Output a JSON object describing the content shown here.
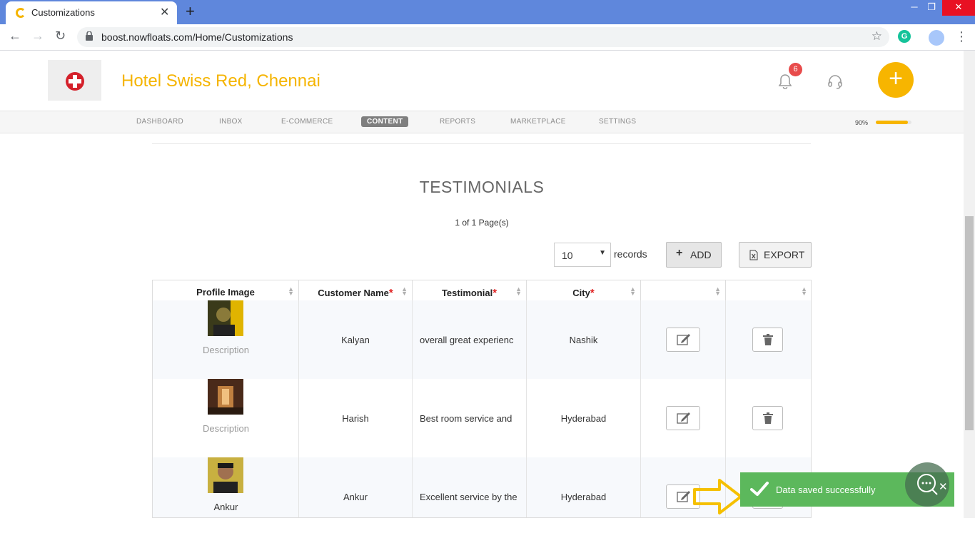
{
  "browser": {
    "tab_title": "Customizations",
    "url": "boost.nowfloats.com/Home/Customizations",
    "grammarly": "G"
  },
  "header": {
    "business_name": "Hotel Swiss Red, Chennai",
    "notification_count": "6",
    "add_label": "+"
  },
  "nav": {
    "items": [
      "DASHBOARD",
      "INBOX",
      "E-COMMERCE",
      "CONTENT",
      "REPORTS",
      "MARKETPLACE",
      "SETTINGS"
    ],
    "active": "CONTENT",
    "progress_label": "90%",
    "progress_fraction": 0.9
  },
  "section": {
    "title": "TESTIMONIALS",
    "page_info": "1 of 1 Page(s)",
    "records_value": "10",
    "records_label": "records",
    "add_label": "ADD",
    "export_label": "EXPORT"
  },
  "table": {
    "headers": [
      "Profile Image",
      "Customer Name",
      "Testimonial",
      "City",
      "",
      ""
    ],
    "rows": [
      {
        "caption": "Description",
        "name": "Kalyan",
        "testimonial": "overall great experienc",
        "city": "Nashik"
      },
      {
        "caption": "Description",
        "name": "Harish",
        "testimonial": "Best room service and ",
        "city": "Hyderabad"
      },
      {
        "caption": "Ankur",
        "name": "Ankur",
        "testimonial": "Excellent service by the",
        "city": "Hyderabad"
      }
    ]
  },
  "toast": {
    "message": "Data saved successfully"
  },
  "colors": {
    "brand": "#f5b400",
    "toast": "#5cb85c",
    "required": "#e02020",
    "chrome": "#5f87dc"
  }
}
